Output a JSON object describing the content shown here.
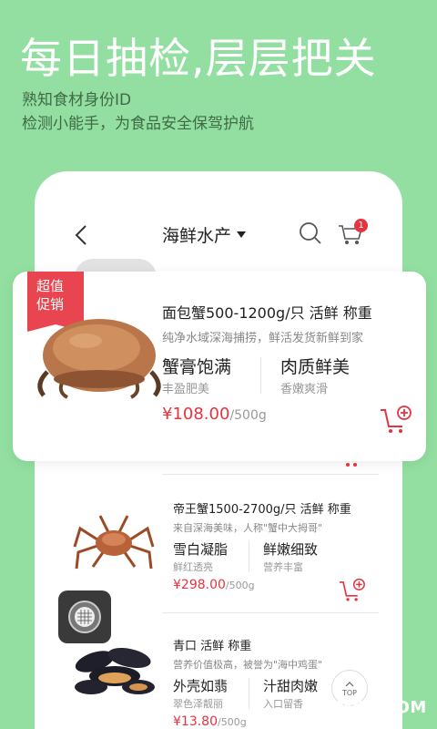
{
  "promo": {
    "headline": "每日抽检,层层把关",
    "subline1": "熟知食材身份ID",
    "subline2": "检测小能手，为食品安全保驾护航"
  },
  "navbar": {
    "back_icon": "chevron-left-icon",
    "category_title": "海鲜水产",
    "dropdown_icon": "caret-down-icon",
    "search_icon": "search-icon",
    "cart_icon": "cart-icon",
    "cart_badge_count": "1"
  },
  "featured_product": {
    "ribbon_label": "超值促销",
    "title": "面包蟹500-1200g/只 活鲜 称重",
    "description": "纯净水域深海捕捞，鲜活发货新鲜到家",
    "feature1": {
      "label": "蟹膏饱满",
      "sub": "丰盈肥美"
    },
    "feature2": {
      "label": "肉质鲜美",
      "sub": "香嫩爽滑"
    },
    "price": "¥108.00",
    "unit": "/500g"
  },
  "products": [
    {
      "title": "帝王蟹1500-2700g/只 活鲜 称重",
      "description": "来自深海美味，人称\"蟹中大拇哥\"",
      "feature1": {
        "label": "雪白凝脂",
        "sub": "鲜红透亮"
      },
      "feature2": {
        "label": "鲜嫩细致",
        "sub": "营养丰富"
      },
      "price": "¥298.00",
      "unit": "/500g"
    },
    {
      "title": "青口 活鲜 称重",
      "description": "营养价值极高，被誉为\"海中鸡蛋\"",
      "feature1": {
        "label": "外壳如翡",
        "sub": "翠色泽靓丽"
      },
      "feature2": {
        "label": "汁甜肉嫩",
        "sub": "入口留香"
      },
      "price": "¥13.80",
      "unit": "/500g"
    }
  ],
  "back_to_top_label": "TOP",
  "watermark": "ITMOP.COM",
  "colors": {
    "background": "#93dfa1",
    "price_red": "#e8323d",
    "ribbon_red": "#e84550"
  }
}
